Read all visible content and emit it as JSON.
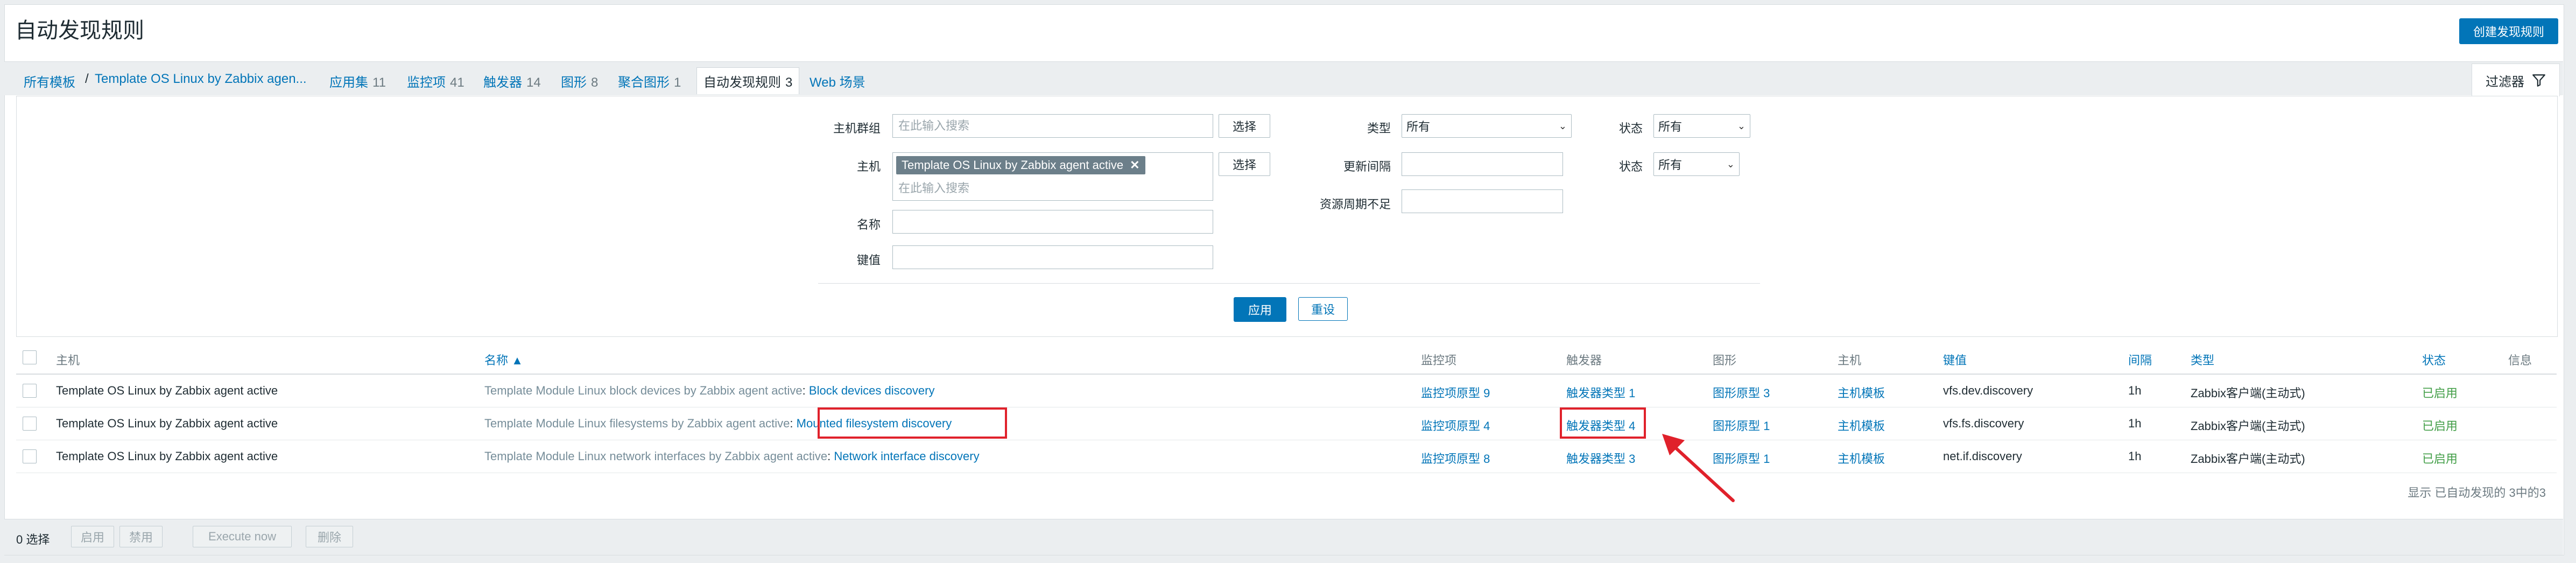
{
  "page": {
    "title": "自动发现规则",
    "create_button": "创建发现规则"
  },
  "nav": {
    "all_templates": "所有模板",
    "separator": "/",
    "template_name": "Template OS Linux by Zabbix agen...",
    "apps": {
      "label": "应用集",
      "count": "11"
    },
    "items": {
      "label": "监控项",
      "count": "41"
    },
    "triggers": {
      "label": "触发器",
      "count": "14"
    },
    "graphs": {
      "label": "图形",
      "count": "8"
    },
    "screens": {
      "label": "聚合图形",
      "count": "1"
    },
    "discovery": {
      "label": "自动发现规则",
      "count": "3"
    },
    "web": {
      "label": "Web 场景"
    }
  },
  "filter": {
    "tab_label": "过滤器",
    "host_group_label": "主机群组",
    "host_group_placeholder": "在此输入搜索",
    "select_label": "选择",
    "host_label": "主机",
    "host_tag": "Template OS Linux by Zabbix agent active",
    "host_placeholder": "在此输入搜索",
    "name_label": "名称",
    "key_label": "键值",
    "type_label": "类型",
    "type_value": "所有",
    "update_interval_label": "更新间隔",
    "lifetime_label": "资源周期不足",
    "status_label": "状态",
    "status_value": "所有",
    "state_label": "状态",
    "state_value": "所有",
    "apply": "应用",
    "reset": "重设"
  },
  "table": {
    "headers": {
      "host": "主机",
      "name": "名称 ▲",
      "items": "监控项",
      "triggers": "触发器",
      "graphs": "图形",
      "hosts": "主机",
      "key": "键值",
      "interval": "间隔",
      "type": "类型",
      "status": "状态",
      "info": "信息"
    },
    "rows": [
      {
        "host": "Template OS Linux by Zabbix agent active",
        "name_prefix": "Template Module Linux block devices by Zabbix agent active",
        "name_sep": ": ",
        "name": "Block devices discovery",
        "items": "监控项原型 9",
        "triggers": "触发器类型 1",
        "graphs": "图形原型 3",
        "hosts": "主机模板",
        "key": "vfs.dev.discovery",
        "interval": "1h",
        "type": "Zabbix客户端(主动式)",
        "status": "已启用"
      },
      {
        "host": "Template OS Linux by Zabbix agent active",
        "name_prefix": "Template Module Linux filesystems by Zabbix agent active",
        "name_sep": ": ",
        "name": "Mounted filesystem discovery",
        "items": "监控项原型 4",
        "triggers": "触发器类型 4",
        "graphs": "图形原型 1",
        "hosts": "主机模板",
        "key": "vfs.fs.discovery",
        "interval": "1h",
        "type": "Zabbix客户端(主动式)",
        "status": "已启用"
      },
      {
        "host": "Template OS Linux by Zabbix agent active",
        "name_prefix": "Template Module Linux network interfaces by Zabbix agent active",
        "name_sep": ": ",
        "name": "Network interface discovery",
        "items": "监控项原型 8",
        "triggers": "触发器类型 3",
        "graphs": "图形原型 1",
        "hosts": "主机模板",
        "key": "net.if.discovery",
        "interval": "1h",
        "type": "Zabbix客户端(主动式)",
        "status": "已启用"
      }
    ],
    "footer": "显示 已自动发现的 3中的3"
  },
  "actions": {
    "selected": "0 选择",
    "enable": "启用",
    "disable": "禁用",
    "execute": "Execute now",
    "delete": "删除"
  },
  "colors": {
    "link": "#0275b8",
    "enabled": "#429e47",
    "annotation": "#e0212b"
  }
}
